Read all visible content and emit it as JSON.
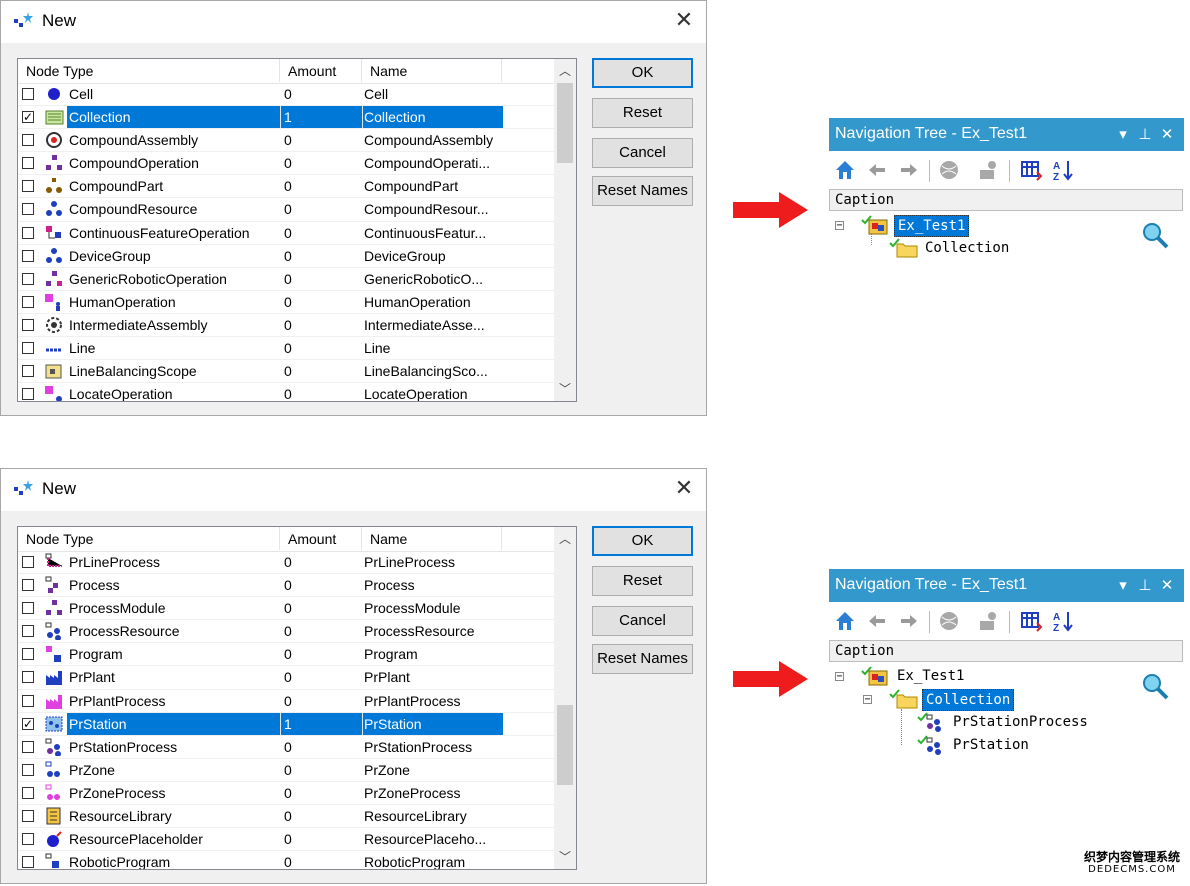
{
  "dialog1": {
    "title": "New",
    "close": "✕",
    "headers": [
      "Node Type",
      "Amount",
      "Name"
    ],
    "rows": [
      {
        "type": "Cell",
        "amount": "0",
        "name": "Cell",
        "checked": false,
        "icon": "cell-icon"
      },
      {
        "type": "Collection",
        "amount": "1",
        "name": "Collection",
        "checked": true,
        "selected": true,
        "icon": "collection-icon"
      },
      {
        "type": "CompoundAssembly",
        "amount": "0",
        "name": "CompoundAssembly",
        "checked": false,
        "icon": "compound-assembly-icon"
      },
      {
        "type": "CompoundOperation",
        "amount": "0",
        "name": "CompoundOperati...",
        "checked": false,
        "icon": "compound-operation-icon"
      },
      {
        "type": "CompoundPart",
        "amount": "0",
        "name": "CompoundPart",
        "checked": false,
        "icon": "compound-part-icon"
      },
      {
        "type": "CompoundResource",
        "amount": "0",
        "name": "CompoundResour...",
        "checked": false,
        "icon": "compound-resource-icon"
      },
      {
        "type": "ContinuousFeatureOperation",
        "amount": "0",
        "name": "ContinuousFeatur...",
        "checked": false,
        "icon": "continuous-feature-operation-icon"
      },
      {
        "type": "DeviceGroup",
        "amount": "0",
        "name": "DeviceGroup",
        "checked": false,
        "icon": "device-group-icon"
      },
      {
        "type": "GenericRoboticOperation",
        "amount": "0",
        "name": "GenericRoboticO...",
        "checked": false,
        "icon": "generic-robotic-operation-icon"
      },
      {
        "type": "HumanOperation",
        "amount": "0",
        "name": "HumanOperation",
        "checked": false,
        "icon": "human-operation-icon"
      },
      {
        "type": "IntermediateAssembly",
        "amount": "0",
        "name": "IntermediateAsse...",
        "checked": false,
        "icon": "intermediate-assembly-icon"
      },
      {
        "type": "Line",
        "amount": "0",
        "name": "Line",
        "checked": false,
        "icon": "line-icon"
      },
      {
        "type": "LineBalancingScope",
        "amount": "0",
        "name": "LineBalancingSco...",
        "checked": false,
        "icon": "line-balancing-scope-icon"
      },
      {
        "type": "LocateOperation",
        "amount": "0",
        "name": "LocateOperation",
        "checked": false,
        "icon": "locate-operation-icon"
      }
    ],
    "buttons": {
      "ok": "OK",
      "reset": "Reset",
      "cancel": "Cancel",
      "reset_names": "Reset Names"
    }
  },
  "dialog2": {
    "title": "New",
    "close": "✕",
    "headers": [
      "Node Type",
      "Amount",
      "Name"
    ],
    "rows": [
      {
        "type": "PrLineProcess",
        "amount": "0",
        "name": "PrLineProcess",
        "checked": false,
        "icon": "pr-line-process-icon"
      },
      {
        "type": "Process",
        "amount": "0",
        "name": "Process",
        "checked": false,
        "icon": "process-icon"
      },
      {
        "type": "ProcessModule",
        "amount": "0",
        "name": "ProcessModule",
        "checked": false,
        "icon": "process-module-icon"
      },
      {
        "type": "ProcessResource",
        "amount": "0",
        "name": "ProcessResource",
        "checked": false,
        "icon": "process-resource-icon"
      },
      {
        "type": "Program",
        "amount": "0",
        "name": "Program",
        "checked": false,
        "icon": "program-icon"
      },
      {
        "type": "PrPlant",
        "amount": "0",
        "name": "PrPlant",
        "checked": false,
        "icon": "pr-plant-icon"
      },
      {
        "type": "PrPlantProcess",
        "amount": "0",
        "name": "PrPlantProcess",
        "checked": false,
        "icon": "pr-plant-process-icon"
      },
      {
        "type": "PrStation",
        "amount": "1",
        "name": "PrStation",
        "checked": true,
        "selected": true,
        "icon": "pr-station-icon"
      },
      {
        "type": "PrStationProcess",
        "amount": "0",
        "name": "PrStationProcess",
        "checked": false,
        "icon": "pr-station-process-icon"
      },
      {
        "type": "PrZone",
        "amount": "0",
        "name": "PrZone",
        "checked": false,
        "icon": "pr-zone-icon"
      },
      {
        "type": "PrZoneProcess",
        "amount": "0",
        "name": "PrZoneProcess",
        "checked": false,
        "icon": "pr-zone-process-icon"
      },
      {
        "type": "ResourceLibrary",
        "amount": "0",
        "name": "ResourceLibrary",
        "checked": false,
        "icon": "resource-library-icon"
      },
      {
        "type": "ResourcePlaceholder",
        "amount": "0",
        "name": "ResourcePlaceho...",
        "checked": false,
        "icon": "resource-placeholder-icon"
      },
      {
        "type": "RoboticProgram",
        "amount": "0",
        "name": "RoboticProgram",
        "checked": false,
        "icon": "robotic-program-icon"
      }
    ],
    "buttons": {
      "ok": "OK",
      "reset": "Reset",
      "cancel": "Cancel",
      "reset_names": "Reset Names"
    }
  },
  "nav1": {
    "title": "Navigation Tree - Ex_Test1",
    "caption": "Caption",
    "nodes": [
      "Ex_Test1",
      "Collection"
    ]
  },
  "nav2": {
    "title": "Navigation Tree - Ex_Test1",
    "caption": "Caption",
    "nodes": [
      "Ex_Test1",
      "Collection",
      "PrStationProcess",
      "PrStation"
    ]
  },
  "nav_buttons": {
    "pin": "▾",
    "dock": "⊥",
    "close": "✕"
  },
  "colors": {
    "selection": "#0078d7",
    "nav_title_bg": "#3399cc",
    "arrow": "#ee1c1c"
  },
  "watermark": {
    "line1": "织梦内容管理系统",
    "line2": "DEDECMS.COM"
  }
}
